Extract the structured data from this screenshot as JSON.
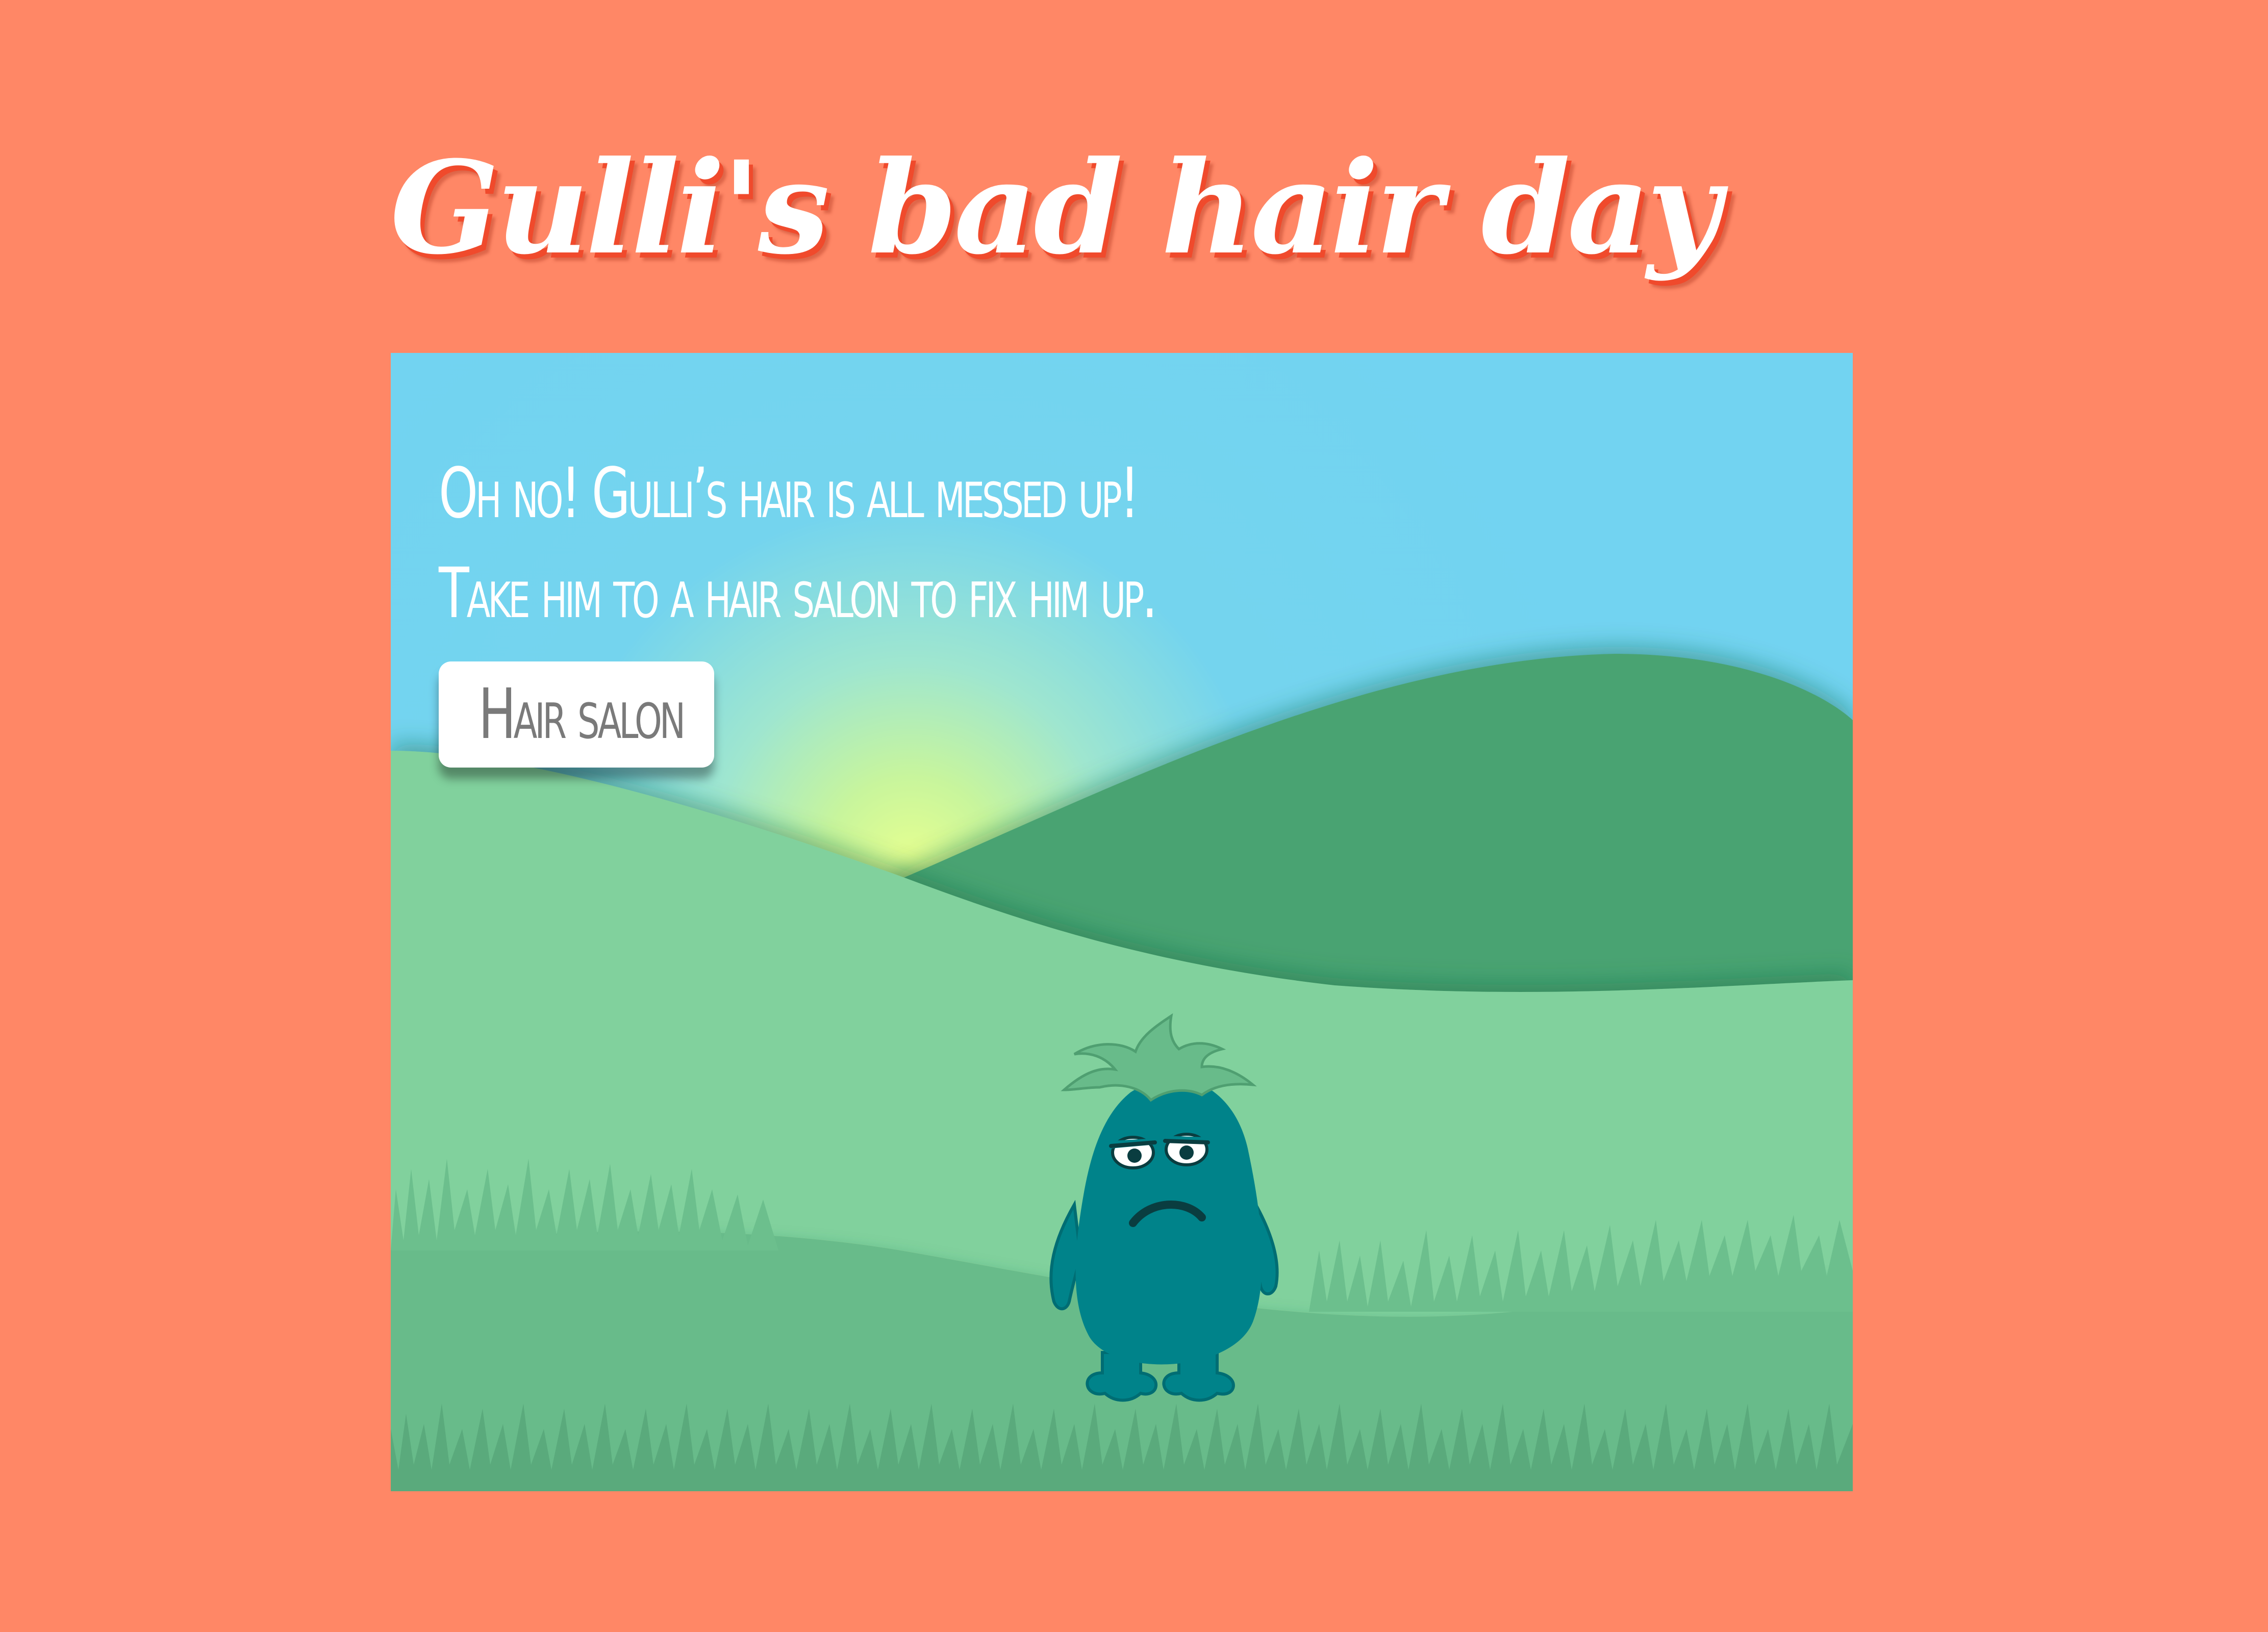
{
  "game": {
    "title": "Gulli's bad hair day",
    "story_lines": [
      "Oh no! Gulli’s hair is all messed up!",
      "Take him to a hair salon to fix him up."
    ],
    "button_label": "Hair salon"
  },
  "character": {
    "name_icon": "gulli-monster",
    "mood": "grumpy"
  },
  "colors": {
    "background": "#ff8766",
    "sky": "#72d3f1",
    "hill_dark": "#49a372",
    "hill_light": "#81d19d",
    "meadow": "#68bb8a",
    "monster_body": "#00838a",
    "monster_hair": "#68bb8a"
  }
}
